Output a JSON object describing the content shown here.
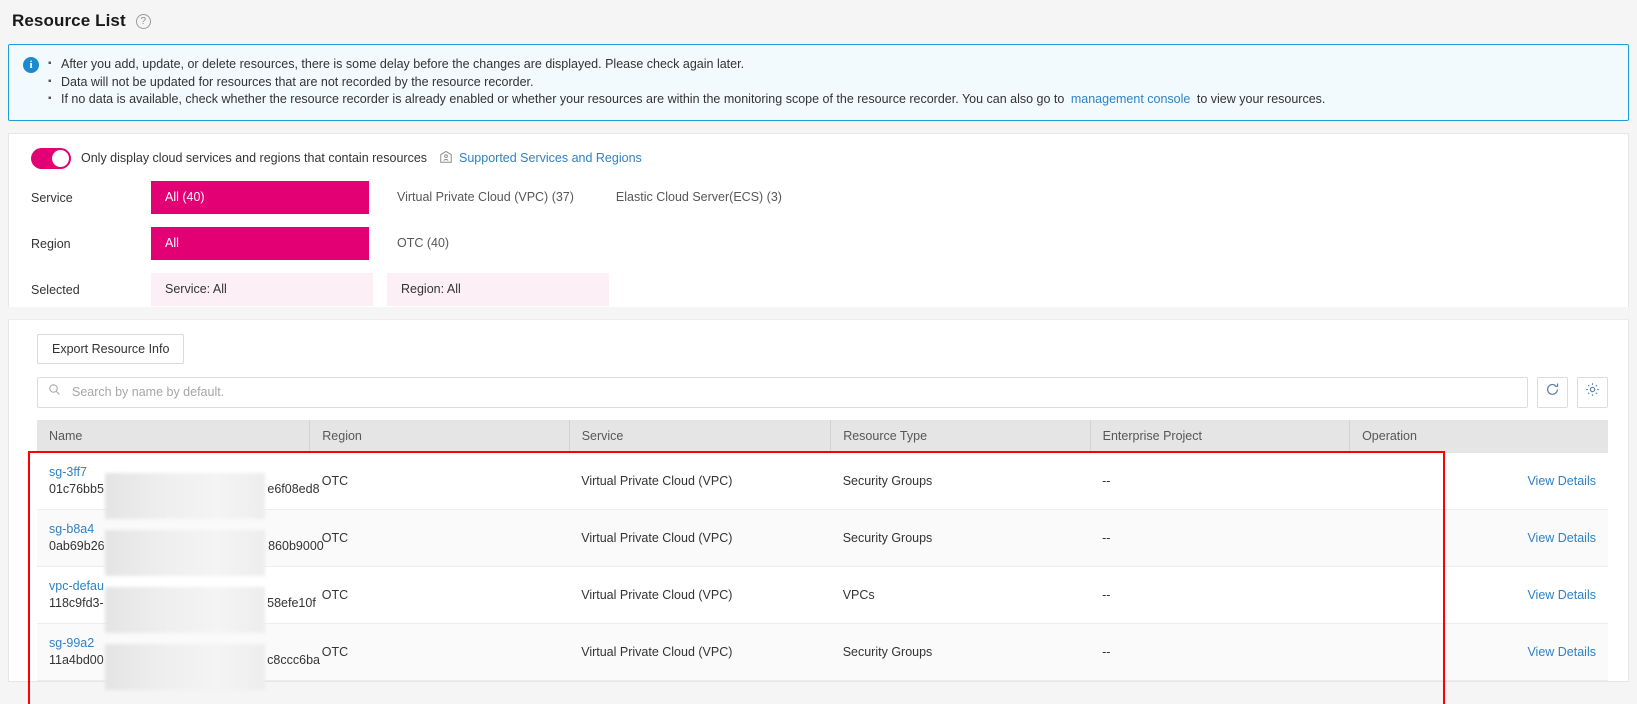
{
  "header": {
    "title": "Resource List",
    "help_icon": "question-circle-icon"
  },
  "info_banner": {
    "icon": "info-circle-icon",
    "lines": [
      "After you add, update, or delete resources, there is some delay before the changes are displayed. Please check again later.",
      "Data will not be updated for resources that are not recorded by the resource recorder."
    ],
    "line3_prefix": "If no data is available, check whether the resource recorder is already enabled or whether your resources are within the monitoring scope of the resource recorder. You can also go to",
    "line3_link": "management console",
    "line3_suffix": "to view your resources."
  },
  "filters": {
    "toggle_on": true,
    "toggle_label": "Only display cloud services and regions that contain resources",
    "supported_link": "Supported Services and Regions",
    "supported_icon": "shield-region-icon",
    "service": {
      "label": "Service",
      "options": [
        {
          "label": "All (40)",
          "active": true
        },
        {
          "label": "Virtual Private Cloud (VPC) (37)",
          "active": false
        },
        {
          "label": "Elastic Cloud Server(ECS) (3)",
          "active": false
        }
      ]
    },
    "region": {
      "label": "Region",
      "options": [
        {
          "label": "All",
          "active": true
        },
        {
          "label": "OTC (40)",
          "active": false
        }
      ]
    },
    "selected": {
      "label": "Selected",
      "tags": [
        "Service: All",
        "Region: All"
      ]
    }
  },
  "toolbar": {
    "export_label": "Export Resource Info"
  },
  "search": {
    "placeholder": "Search by name by default.",
    "value": "",
    "search_icon": "search-icon",
    "refresh_icon": "refresh-icon",
    "settings_icon": "gear-icon"
  },
  "table": {
    "columns": [
      "Name",
      "Region",
      "Service",
      "Resource Type",
      "Enterprise Project",
      "Operation"
    ],
    "operation_label": "View Details",
    "rows": [
      {
        "name": "sg-3ff7",
        "id_prefix": "01c76bb5",
        "id_suffix": "e6f08ed8",
        "region": "OTC",
        "service": "Virtual Private Cloud (VPC)",
        "resource_type": "Security Groups",
        "enterprise_project": "--"
      },
      {
        "name": "sg-b8a4",
        "id_prefix": "0ab69b26",
        "id_suffix": "860b9000",
        "region": "OTC",
        "service": "Virtual Private Cloud (VPC)",
        "resource_type": "Security Groups",
        "enterprise_project": "--"
      },
      {
        "name": "vpc-defau",
        "id_prefix": "118c9fd3-",
        "id_suffix": "58efe10f",
        "region": "OTC",
        "service": "Virtual Private Cloud (VPC)",
        "resource_type": "VPCs",
        "enterprise_project": "--"
      },
      {
        "name": "sg-99a2",
        "id_prefix": "11a4bd00",
        "id_suffix": "c8ccc6ba",
        "region": "OTC",
        "service": "Virtual Private Cloud (VPC)",
        "resource_type": "Security Groups",
        "enterprise_project": "--"
      }
    ]
  },
  "colors": {
    "accent": "#e20074",
    "link": "#2f82c4",
    "info_border": "#1b9ed9",
    "annotation": "#ff0000"
  }
}
